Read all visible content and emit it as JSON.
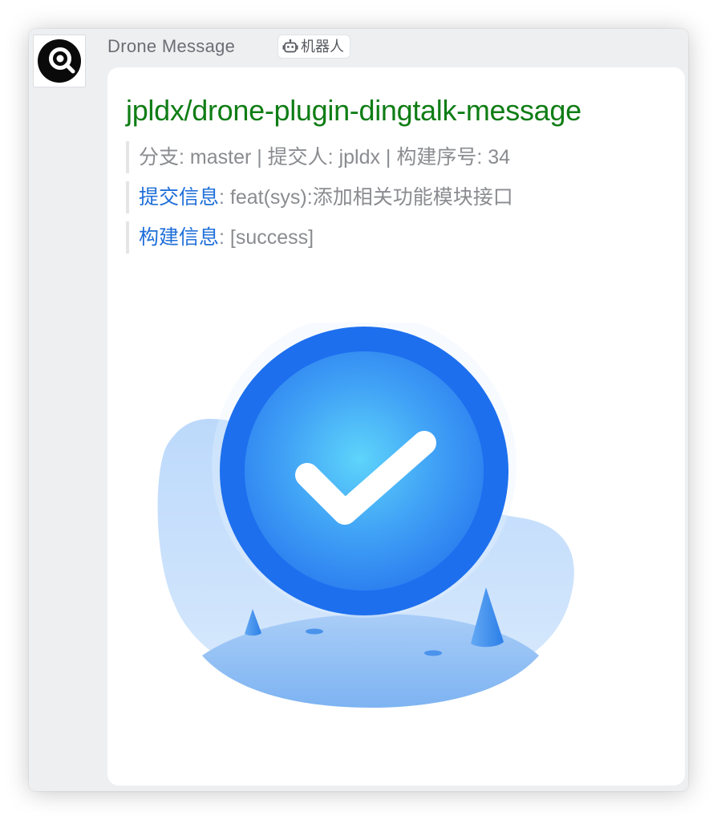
{
  "sender": {
    "name": "Drone Message",
    "avatar_icon": "drone-logo-icon",
    "badge": {
      "icon": "robot-icon",
      "label": "机器人"
    }
  },
  "message": {
    "title": "jpldx/drone-plugin-dingtalk-message",
    "meta_line": "分支: master | 提交人: jpldx | 构建序号: 34",
    "commit": {
      "label": "提交信息",
      "value": ": feat(sys):添加相关功能模块接口"
    },
    "build": {
      "label": "构建信息",
      "value": ": [success]"
    },
    "image_icon": "success-check-illustration"
  },
  "colors": {
    "title_green": "#0f7d15",
    "link_blue": "#1f6fd9",
    "muted_gray": "#8a8c90",
    "window_bg": "#eeeff1"
  }
}
